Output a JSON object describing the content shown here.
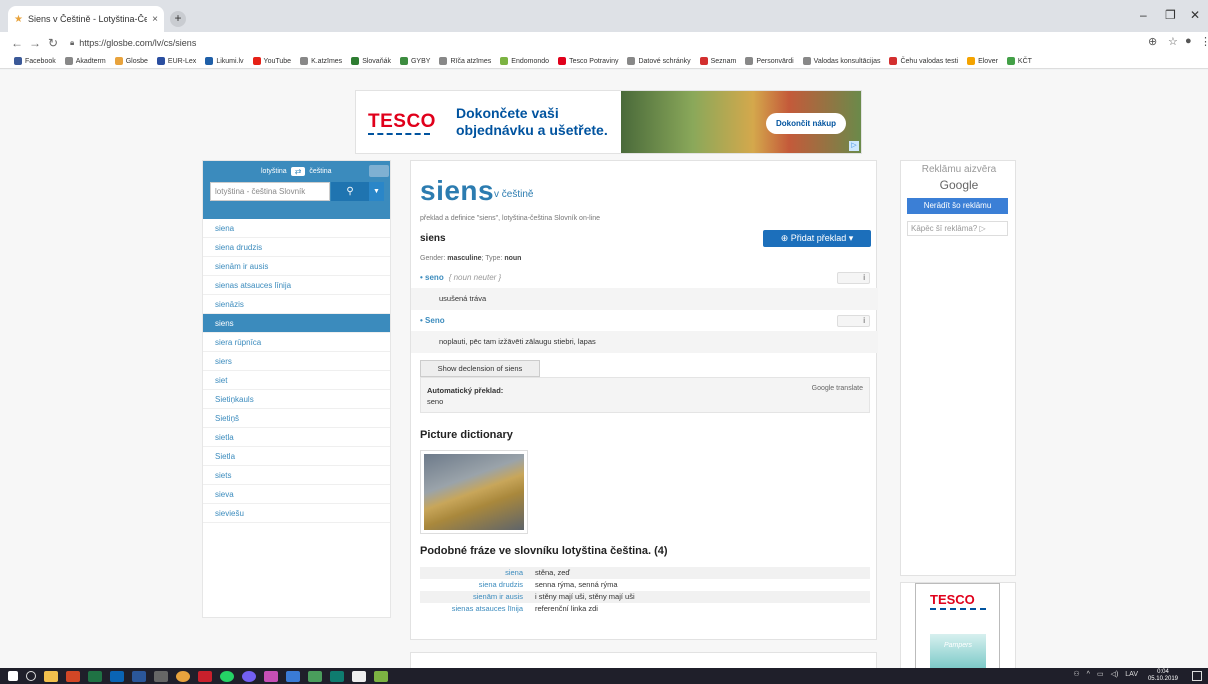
{
  "browser": {
    "tab_title": "Siens v Češtině - Lotyština-Češtin",
    "tab_close": "×",
    "new_tab": "+",
    "url": "https://glosbe.com/lv/cs/siens",
    "bookmarks": [
      {
        "label": "Facebook",
        "color": "#3b5998"
      },
      {
        "label": "Akadterm",
        "color": "#888888"
      },
      {
        "label": "Glosbe",
        "color": "#e8a33d"
      },
      {
        "label": "EUR-Lex",
        "color": "#2a4ea0"
      },
      {
        "label": "Likumi.lv",
        "color": "#1f5fa8"
      },
      {
        "label": "YouTube",
        "color": "#e62117"
      },
      {
        "label": "K.atzīmes",
        "color": "#888888"
      },
      {
        "label": "Slovaňák",
        "color": "#2e7d32"
      },
      {
        "label": "GYBY",
        "color": "#3d8c40"
      },
      {
        "label": "Rīča atzīmes",
        "color": "#888888"
      },
      {
        "label": "Endomondo",
        "color": "#7cb342"
      },
      {
        "label": "Tesco Potraviny",
        "color": "#e0001b"
      },
      {
        "label": "Datové schránky",
        "color": "#888888"
      },
      {
        "label": "Seznam",
        "color": "#d32f2f"
      },
      {
        "label": "Personvārdi",
        "color": "#888888"
      },
      {
        "label": "Valodas konsultācijas",
        "color": "#888888"
      },
      {
        "label": "Čehu valodas testi",
        "color": "#d32f2f"
      },
      {
        "label": "Elover",
        "color": "#f4a300"
      },
      {
        "label": "KČT",
        "color": "#43a047"
      }
    ]
  },
  "ad_banner": {
    "brand": "TESCO",
    "text_line1": "Dokončete vaši",
    "text_line2": "objednávku a ušetřete.",
    "button": "Dokončit nákup"
  },
  "sidebar": {
    "lang_from": "lotyština",
    "lang_to": "čeština",
    "swap": "⇄",
    "search_placeholder": "lotyština - čeština Slovník",
    "search_icon": "search-icon",
    "items": [
      {
        "label": "siena",
        "active": false
      },
      {
        "label": "siena drudzis",
        "active": false
      },
      {
        "label": "sienām ir ausis",
        "active": false
      },
      {
        "label": "sienas atsauces līnija",
        "active": false
      },
      {
        "label": "sienāzis",
        "active": false
      },
      {
        "label": "siens",
        "active": true
      },
      {
        "label": "siera rūpnīca",
        "active": false
      },
      {
        "label": "siers",
        "active": false
      },
      {
        "label": "siet",
        "active": false
      },
      {
        "label": "Sietiņkauls",
        "active": false
      },
      {
        "label": "Sietiņš",
        "active": false
      },
      {
        "label": "sietla",
        "active": false
      },
      {
        "label": "Sietla",
        "active": false
      },
      {
        "label": "siets",
        "active": false
      },
      {
        "label": "sieva",
        "active": false
      },
      {
        "label": "sieviešu",
        "active": false
      }
    ]
  },
  "main": {
    "headword": "siens",
    "headword_sub": "v češtině",
    "description": "překlad a definice \"siens\", lotyština-čeština Slovník on-line",
    "word": "siens",
    "add_button": "Přidat překlad",
    "gender_label": "Gender:",
    "gender_value": "masculine",
    "type_label": "; Type:",
    "type_value": "noun",
    "translations": [
      {
        "term": "seno",
        "grammar": "{ noun neuter }",
        "definition": "usušená tráva"
      },
      {
        "term": "Seno",
        "grammar": "",
        "definition": "noplauti, pēc tam izžāvēti zālaugu stiebri, lapas"
      }
    ],
    "declension_button": "Show declension of siens",
    "auto_label": "Automatický překlad:",
    "auto_value": "seno",
    "google_translate": "Google translate",
    "picture_heading": "Picture dictionary",
    "similar_heading": "Podobné fráze ve slovníku lotyština čeština. (4)",
    "similar": [
      {
        "k": "siena",
        "v": "stěna, zeď"
      },
      {
        "k": "siena drudzis",
        "v": "senna rýma, senná rýma"
      },
      {
        "k": "sienām ir ausis",
        "v": "i stěny mají uši, stěny mají uši"
      },
      {
        "k": "sienas atsauces līnija",
        "v": "referenční linka zdi"
      }
    ]
  },
  "right": {
    "close_ad": "Reklāmu aizvēra",
    "google": "Google",
    "stop_button": "Nerādīt šo reklāmu",
    "why": "Kāpēc šī reklāma? ▷",
    "ad_brand": "TESCO",
    "ad_product": "Pampers"
  },
  "taskbar": {
    "lang": "LAV",
    "time": "0:04",
    "date": "05.10.2019"
  }
}
